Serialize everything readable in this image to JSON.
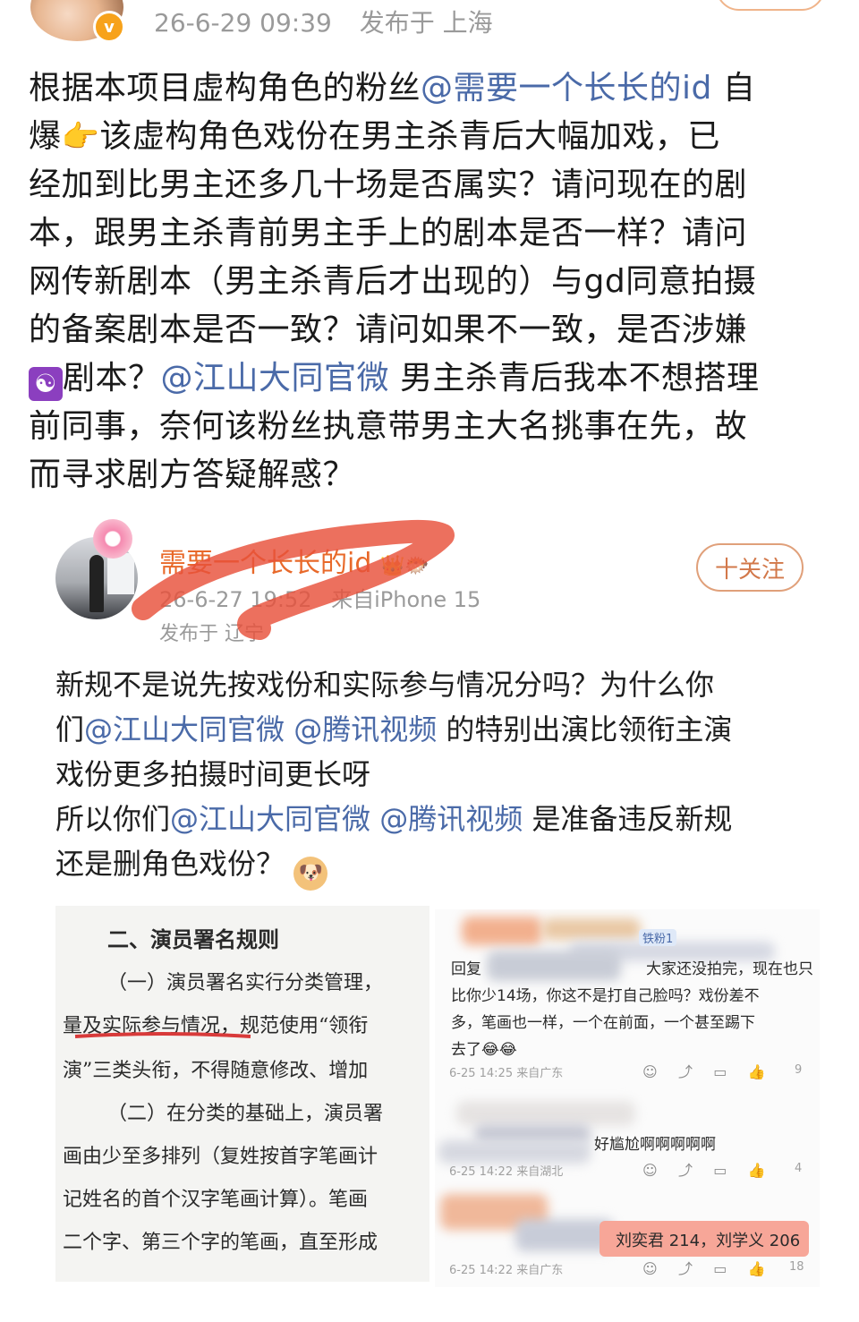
{
  "post": {
    "header": {
      "time": "26-6-29 09:39",
      "location": "发布于 上海",
      "verified_badge": "v"
    },
    "text_lines": [
      [
        "根据本项目虚构角色的粉丝",
        "@需要一个长长的id",
        " 自"
      ],
      [
        "爆",
        "👉",
        "该虚构角色戏份在男主杀青后大幅加戏，已"
      ],
      [
        "经加到比男主还多几十场是否属实？请问现在的剧"
      ],
      [
        "本，跟男主杀青前男主手上的剧本是否一样？请问"
      ],
      [
        "网传新剧本（男主杀青后才出现的）与gd同意拍摄"
      ],
      [
        "的备案剧本是否一致？请问如果不一致，是否涉嫌"
      ],
      [
        "☯",
        "剧本？",
        "@江山大同官微",
        " 男主杀青后我本不想搭理"
      ],
      [
        "前同事，奈何该粉丝执意带男主大名挑事在先，故"
      ],
      [
        "而寻求剧方答疑解惑？"
      ]
    ]
  },
  "quoted": {
    "name": "需要一个长长的id",
    "time": "26-6-27 19:52",
    "source": "来自iPhone 15",
    "location": "发布于 辽宁",
    "follow_label": "十关注",
    "lines": [
      [
        "新规不是说先按戏份和实际参与情况分吗？为什么你"
      ],
      [
        "们",
        "@江山大同官微",
        " ",
        "@腾讯视频",
        " 的特别出演比领衔主演"
      ],
      [
        "戏份更多拍摄时间更长呀"
      ],
      [
        "所以你们",
        "@江山大同官微",
        " ",
        "@腾讯视频",
        " 是准备违反新规"
      ],
      [
        "还是删角色戏份？ ",
        "🐶"
      ]
    ]
  },
  "doc_image": {
    "lines": [
      "二、演员署名规则",
      "（一）演员署名实行分类管理，",
      "量及实际参与情况，规范使用“领衔",
      "演”三类头衔，不得随意修改、增加",
      "（二）在分类的基础上，演员署",
      "画由少至多排列（复姓按首字笔画计",
      "记姓名的首个汉字笔画计算）。笔画",
      "二个字、第三个字的笔画，直至形成"
    ]
  },
  "comments_image": {
    "badge": "铁粉1",
    "comment1": {
      "lines": [
        "回复",
        "大家还没拍完，现在也只",
        "比你少14场，你这不是打自己脸吗？戏份差不",
        "多，笔画也一样，一个在前面，一个甚至踢下",
        "去了😂😂"
      ],
      "meta": "6-25 14:25 来自广东",
      "likes": "9"
    },
    "comment2": {
      "text": "好尴尬啊啊啊啊啊",
      "meta": "6-25 14:22 来自湖北",
      "likes": "4"
    },
    "comment3": {
      "text": "刘奕君 214，刘学义 206",
      "meta": "6-25 14:22 来自广东",
      "likes": "18"
    }
  },
  "colors": {
    "mention": "#4a6aa8",
    "quoted_name": "#e8692a",
    "meta_gray": "#9a9a9a",
    "scribble": "#e8503a"
  }
}
